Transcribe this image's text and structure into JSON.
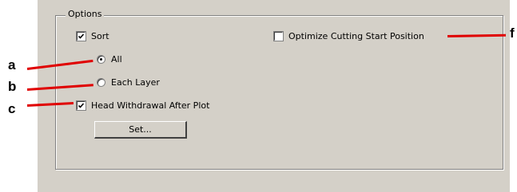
{
  "group": {
    "title": "Options"
  },
  "controls": {
    "sort": {
      "label": "Sort",
      "checked": true
    },
    "radio_all": {
      "label": "All",
      "selected": true
    },
    "radio_each_layer": {
      "label": "Each Layer",
      "selected": false
    },
    "head_withdrawal": {
      "label": "Head Withdrawal After Plot",
      "checked": true
    },
    "set_button": {
      "label": "Set..."
    },
    "optimize": {
      "label": "Optimize Cutting Start Position",
      "checked": false
    }
  },
  "callouts": {
    "a": "a",
    "b": "b",
    "c": "c",
    "f": "f"
  },
  "colors": {
    "panel": "#d4d0c8",
    "callout_line": "#e00000"
  }
}
